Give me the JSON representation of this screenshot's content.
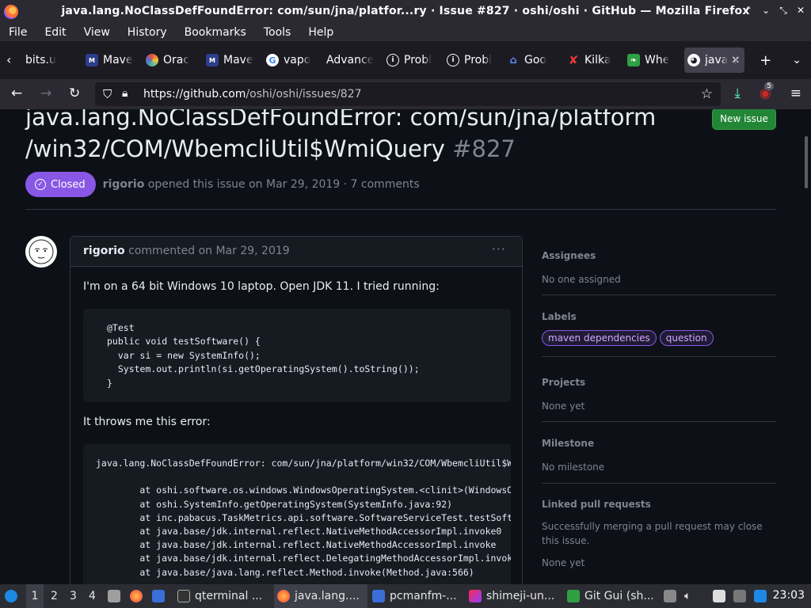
{
  "window": {
    "title": "java.lang.NoClassDefFoundError: com/sun/jna/platfor...ry · Issue #827 · oshi/oshi · GitHub — Mozilla Firefox"
  },
  "menu": [
    "File",
    "Edit",
    "View",
    "History",
    "Bookmarks",
    "Tools",
    "Help"
  ],
  "tabs": [
    {
      "label": "bits.u",
      "icon": "none"
    },
    {
      "label": "Mave",
      "icon": "maven-icon"
    },
    {
      "label": "Orac",
      "icon": "oracle-icon"
    },
    {
      "label": "Mave",
      "icon": "maven-icon"
    },
    {
      "label": "vapo",
      "icon": "google-icon"
    },
    {
      "label": "Advance",
      "icon": "none"
    },
    {
      "label": "Probl",
      "icon": "info-icon"
    },
    {
      "label": "Probl",
      "icon": "info-icon"
    },
    {
      "label": "Goo",
      "icon": "goo-icon"
    },
    {
      "label": "Kilka",
      "icon": "kilka-icon"
    },
    {
      "label": "Whe",
      "icon": "leaf-icon"
    },
    {
      "label": "java",
      "icon": "github-icon",
      "active": true
    }
  ],
  "nav": {
    "url_host": "https://github.com",
    "url_path": "/oshi/oshi/issues/827",
    "badge": "5"
  },
  "issue": {
    "title": "java.lang.NoClassDefFoundError: com/sun/jna/platform /win32/COM/WbemcliUtil$WmiQuery",
    "number": "#827",
    "new_issue": "New issue",
    "state": "Closed",
    "author": "rigorio",
    "meta_text": "opened this issue on Mar 29, 2019 · 7 comments"
  },
  "comment": {
    "author": "rigorio",
    "meta": "commented on Mar 29, 2019",
    "dots": "···",
    "p1": "I'm on a 64 bit Windows 10 laptop. Open JDK 11. I tried running:",
    "code1": "@Test\npublic void testSoftware() {\n  var si = new SystemInfo();\n  System.out.println(si.getOperatingSystem().toString());\n}",
    "p2": "It throws me this error:",
    "code2": "java.lang.NoClassDefFoundError: com/sun/jna/platform/win32/COM/WbemcliUtil$WmiQuery\n\n        at oshi.software.os.windows.WindowsOperatingSystem.<clinit>(WindowsOperatingSystem.java)\n        at oshi.SystemInfo.getOperatingSystem(SystemInfo.java:92)\n        at inc.pabacus.TaskMetrics.api.software.SoftwareServiceTest.testSoftware\n        at java.base/jdk.internal.reflect.NativeMethodAccessorImpl.invoke0\n        at java.base/jdk.internal.reflect.NativeMethodAccessorImpl.invoke\n        at java.base/jdk.internal.reflect.DelegatingMethodAccessorImpl.invoke\n        at java.base/java.lang.reflect.Method.invoke(Method.java:566)"
  },
  "sidebar": {
    "assignees_title": "Assignees",
    "assignees_value": "No one assigned",
    "labels_title": "Labels",
    "labels": [
      "maven dependencies",
      "question"
    ],
    "projects_title": "Projects",
    "projects_value": "None yet",
    "milestone_title": "Milestone",
    "milestone_value": "No milestone",
    "linked_title": "Linked pull requests",
    "linked_desc": "Successfully merging a pull request may close this issue.",
    "linked_value": "None yet"
  },
  "taskbar": {
    "workspaces": [
      "1",
      "2",
      "3",
      "4"
    ],
    "apps": [
      {
        "label": "qterminal ...",
        "icon": "terminal-icon"
      },
      {
        "label": "java.lang....",
        "icon": "firefox-icon",
        "active": true
      },
      {
        "label": "pcmanfm-...",
        "icon": "folder-icon"
      },
      {
        "label": "shimeji-un...",
        "icon": "intellij-icon"
      },
      {
        "label": "Git Gui (sh...",
        "icon": "git-icon"
      }
    ],
    "clock": "23:03"
  },
  "colors": {
    "accent_green": "#238636",
    "closed_purple": "#8957e5",
    "bg": "#0d1117"
  }
}
